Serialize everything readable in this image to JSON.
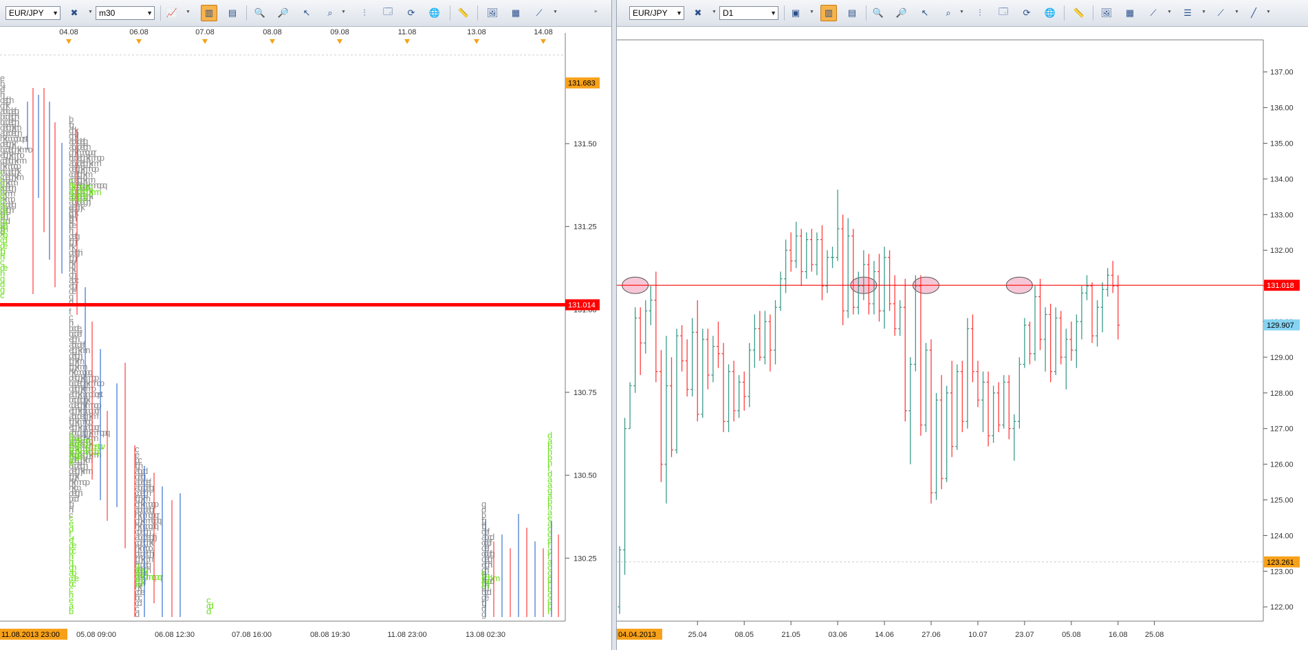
{
  "left_panel": {
    "symbol": "EUR/JPY",
    "timeframe": "m30",
    "price_axis_labels": [
      "131.50",
      "131.25",
      "131.00",
      "130.75",
      "130.50",
      "130.25"
    ],
    "price_axis_values": [
      131.5,
      131.25,
      131.0,
      130.75,
      130.5,
      130.25
    ],
    "top_date_labels": [
      "04.08",
      "06.08",
      "07.08",
      "08.08",
      "09.08",
      "11.08",
      "13.08",
      "14.08"
    ],
    "bottom_time_labels": [
      "05.08 09:00",
      "06.08 12:30",
      "07.08 16:00",
      "08.08 19:30",
      "11.08 23:00",
      "13.08 02:30"
    ],
    "start_marker": "11.08.2013 23:00",
    "high_marker": "131.683",
    "current_price": "131.014"
  },
  "right_panel": {
    "symbol": "EUR/JPY",
    "timeframe": "D1",
    "price_axis_labels": [
      "137.00",
      "136.00",
      "135.00",
      "134.00",
      "133.00",
      "132.00",
      "131.00",
      "130.00",
      "129.00",
      "128.00",
      "127.00",
      "126.00",
      "125.00",
      "124.00",
      "123.00",
      "122.00"
    ],
    "date_labels": [
      "25.04",
      "08.05",
      "21.05",
      "03.06",
      "14.06",
      "27.06",
      "10.07",
      "23.07",
      "05.08",
      "16.08",
      "25.08"
    ],
    "start_marker": "04.04.2013",
    "current_price": "131.018",
    "crosshair_price": "129.907",
    "low_marker": "123.261"
  },
  "colors": {
    "accent_orange": "#f7a11a",
    "current_red": "#ff0000",
    "up_bar": "#3a9a8a",
    "down_bar": "#ff3b3b",
    "highlight_pink": "#f6c6d6",
    "letter_gray": "#8c8c8c",
    "letter_green": "#6de01e",
    "crosshair_blue": "#86d3f2"
  },
  "chart_data": [
    {
      "type": "ohlc",
      "title": "",
      "symbol": "EUR/JPY",
      "timeframe": "m30",
      "ylim": [
        130.06,
        131.73
      ],
      "current_price": 131.014,
      "high_marker": 131.683,
      "notes": "30-minute bars overlaid with market-profile TPO letter columns (gray and green letters)"
    },
    {
      "type": "ohlc",
      "title": "",
      "symbol": "EUR/JPY",
      "timeframe": "D1",
      "ylim": [
        121.6,
        137.9
      ],
      "current_price": 131.018,
      "crosshair_price": 129.907,
      "low_marker": 123.261,
      "highlighted_touches": [
        "09.04",
        "10.06",
        "26.06",
        "22.07"
      ],
      "bars": [
        {
          "d": "04.04",
          "o": 122.0,
          "h": 123.7,
          "l": 121.8,
          "c": 123.6
        },
        {
          "d": "05.04",
          "o": 123.6,
          "h": 127.3,
          "l": 122.9,
          "c": 127.0
        },
        {
          "d": "08.04",
          "o": 127.0,
          "h": 128.3,
          "l": 127.0,
          "c": 128.2
        },
        {
          "d": "09.04",
          "o": 128.2,
          "h": 130.4,
          "l": 128.0,
          "c": 130.1
        },
        {
          "d": "10.04",
          "o": 130.1,
          "h": 130.4,
          "l": 128.5,
          "c": 129.4
        },
        {
          "d": "11.04",
          "o": 129.4,
          "h": 130.6,
          "l": 129.1,
          "c": 130.3
        },
        {
          "d": "12.04",
          "o": 130.3,
          "h": 131.0,
          "l": 129.9,
          "c": 130.6
        },
        {
          "d": "15.04",
          "o": 130.6,
          "h": 131.4,
          "l": 128.3,
          "c": 128.6
        },
        {
          "d": "16.04",
          "o": 128.6,
          "h": 129.2,
          "l": 125.5,
          "c": 126.0
        },
        {
          "d": "17.04",
          "o": 126.0,
          "h": 129.6,
          "l": 124.9,
          "c": 128.2
        },
        {
          "d": "18.04",
          "o": 128.2,
          "h": 129.0,
          "l": 126.2,
          "c": 126.4
        },
        {
          "d": "19.04",
          "o": 126.4,
          "h": 129.8,
          "l": 126.3,
          "c": 129.6
        },
        {
          "d": "22.04",
          "o": 129.6,
          "h": 129.9,
          "l": 128.6,
          "c": 128.9
        },
        {
          "d": "23.04",
          "o": 128.9,
          "h": 129.5,
          "l": 127.9,
          "c": 128.1
        },
        {
          "d": "24.04",
          "o": 128.1,
          "h": 130.1,
          "l": 127.9,
          "c": 129.7
        },
        {
          "d": "25.04",
          "o": 129.7,
          "h": 130.6,
          "l": 127.2,
          "c": 127.4
        },
        {
          "d": "26.04",
          "o": 127.4,
          "h": 129.8,
          "l": 127.3,
          "c": 129.5
        },
        {
          "d": "29.04",
          "o": 129.5,
          "h": 129.8,
          "l": 128.1,
          "c": 128.5
        },
        {
          "d": "30.04",
          "o": 128.5,
          "h": 129.6,
          "l": 128.3,
          "c": 129.3
        },
        {
          "d": "01.05",
          "o": 129.3,
          "h": 130.0,
          "l": 128.7,
          "c": 129.1
        },
        {
          "d": "02.05",
          "o": 129.1,
          "h": 129.4,
          "l": 126.9,
          "c": 127.2
        },
        {
          "d": "03.05",
          "o": 127.2,
          "h": 128.8,
          "l": 126.9,
          "c": 128.6
        },
        {
          "d": "06.05",
          "o": 128.6,
          "h": 128.9,
          "l": 127.2,
          "c": 127.5
        },
        {
          "d": "07.05",
          "o": 127.5,
          "h": 128.5,
          "l": 127.3,
          "c": 128.3
        },
        {
          "d": "08.05",
          "o": 128.3,
          "h": 128.6,
          "l": 127.5,
          "c": 127.9
        },
        {
          "d": "09.05",
          "o": 127.9,
          "h": 129.4,
          "l": 127.6,
          "c": 129.2
        },
        {
          "d": "10.05",
          "o": 129.2,
          "h": 130.2,
          "l": 128.7,
          "c": 129.8
        },
        {
          "d": "13.05",
          "o": 129.8,
          "h": 130.3,
          "l": 128.9,
          "c": 129.0
        },
        {
          "d": "14.05",
          "o": 129.0,
          "h": 130.3,
          "l": 128.8,
          "c": 130.0
        },
        {
          "d": "15.05",
          "o": 130.0,
          "h": 130.2,
          "l": 128.6,
          "c": 129.2
        },
        {
          "d": "16.05",
          "o": 129.2,
          "h": 130.6,
          "l": 128.8,
          "c": 130.4
        },
        {
          "d": "17.05",
          "o": 130.4,
          "h": 131.4,
          "l": 130.3,
          "c": 131.2
        },
        {
          "d": "20.05",
          "o": 131.2,
          "h": 132.3,
          "l": 130.8,
          "c": 132.0
        },
        {
          "d": "21.05",
          "o": 132.0,
          "h": 132.5,
          "l": 131.4,
          "c": 131.7
        },
        {
          "d": "22.05",
          "o": 131.7,
          "h": 132.8,
          "l": 131.5,
          "c": 132.4
        },
        {
          "d": "23.05",
          "o": 132.4,
          "h": 132.6,
          "l": 131.0,
          "c": 131.4
        },
        {
          "d": "24.05",
          "o": 131.4,
          "h": 132.5,
          "l": 131.2,
          "c": 132.3
        },
        {
          "d": "27.05",
          "o": 132.3,
          "h": 132.6,
          "l": 131.4,
          "c": 131.6
        },
        {
          "d": "28.05",
          "o": 131.6,
          "h": 132.5,
          "l": 131.3,
          "c": 132.3
        },
        {
          "d": "29.05",
          "o": 132.3,
          "h": 132.7,
          "l": 130.6,
          "c": 131.0
        },
        {
          "d": "30.05",
          "o": 131.0,
          "h": 132.0,
          "l": 130.8,
          "c": 131.8
        },
        {
          "d": "31.05",
          "o": 131.8,
          "h": 132.1,
          "l": 131.5,
          "c": 131.8
        },
        {
          "d": "03.06",
          "o": 131.8,
          "h": 133.7,
          "l": 131.7,
          "c": 132.6
        },
        {
          "d": "04.06",
          "o": 132.6,
          "h": 133.0,
          "l": 129.9,
          "c": 130.3
        },
        {
          "d": "05.06",
          "o": 130.3,
          "h": 132.9,
          "l": 130.1,
          "c": 132.4
        },
        {
          "d": "06.06",
          "o": 132.4,
          "h": 132.6,
          "l": 130.2,
          "c": 130.4
        },
        {
          "d": "07.06",
          "o": 130.4,
          "h": 131.4,
          "l": 130.2,
          "c": 131.0
        },
        {
          "d": "10.06",
          "o": 131.0,
          "h": 132.0,
          "l": 130.6,
          "c": 131.6
        },
        {
          "d": "11.06",
          "o": 131.6,
          "h": 131.9,
          "l": 130.2,
          "c": 130.5
        },
        {
          "d": "12.06",
          "o": 130.5,
          "h": 131.7,
          "l": 130.2,
          "c": 131.4
        },
        {
          "d": "13.06",
          "o": 131.4,
          "h": 131.9,
          "l": 130.0,
          "c": 130.3
        },
        {
          "d": "14.06",
          "o": 130.3,
          "h": 132.1,
          "l": 129.8,
          "c": 131.8
        },
        {
          "d": "17.06",
          "o": 131.8,
          "h": 132.0,
          "l": 130.3,
          "c": 130.5
        },
        {
          "d": "18.06",
          "o": 130.5,
          "h": 131.3,
          "l": 129.6,
          "c": 129.8
        },
        {
          "d": "19.06",
          "o": 129.8,
          "h": 130.6,
          "l": 129.6,
          "c": 130.4
        },
        {
          "d": "20.06",
          "o": 130.4,
          "h": 131.2,
          "l": 127.2,
          "c": 127.5
        },
        {
          "d": "21.06",
          "o": 127.5,
          "h": 129.0,
          "l": 126.0,
          "c": 128.8
        },
        {
          "d": "24.06",
          "o": 128.8,
          "h": 131.3,
          "l": 128.6,
          "c": 131.0
        },
        {
          "d": "25.06",
          "o": 131.0,
          "h": 131.3,
          "l": 126.8,
          "c": 127.1
        },
        {
          "d": "26.06",
          "o": 127.1,
          "h": 129.4,
          "l": 126.9,
          "c": 129.2
        },
        {
          "d": "27.06",
          "o": 129.2,
          "h": 129.5,
          "l": 124.9,
          "c": 125.2
        },
        {
          "d": "28.06",
          "o": 125.2,
          "h": 128.0,
          "l": 125.0,
          "c": 127.8
        },
        {
          "d": "01.07",
          "o": 127.8,
          "h": 128.5,
          "l": 125.3,
          "c": 125.6
        },
        {
          "d": "02.07",
          "o": 125.6,
          "h": 128.2,
          "l": 125.5,
          "c": 128.0
        },
        {
          "d": "03.07",
          "o": 128.0,
          "h": 128.9,
          "l": 126.2,
          "c": 126.5
        },
        {
          "d": "04.07",
          "o": 126.5,
          "h": 128.8,
          "l": 126.4,
          "c": 128.6
        },
        {
          "d": "05.07",
          "o": 128.6,
          "h": 128.9,
          "l": 126.9,
          "c": 127.2
        },
        {
          "d": "08.07",
          "o": 127.2,
          "h": 130.1,
          "l": 127.0,
          "c": 129.8
        },
        {
          "d": "09.07",
          "o": 129.8,
          "h": 130.2,
          "l": 128.3,
          "c": 128.6
        },
        {
          "d": "10.07",
          "o": 128.6,
          "h": 128.9,
          "l": 127.6,
          "c": 127.8
        },
        {
          "d": "11.07",
          "o": 127.8,
          "h": 128.6,
          "l": 126.9,
          "c": 128.3
        },
        {
          "d": "12.07",
          "o": 128.3,
          "h": 128.6,
          "l": 126.5,
          "c": 126.8
        },
        {
          "d": "15.07",
          "o": 126.8,
          "h": 128.2,
          "l": 126.6,
          "c": 128.0
        },
        {
          "d": "16.07",
          "o": 128.0,
          "h": 128.3,
          "l": 126.9,
          "c": 127.1
        },
        {
          "d": "17.07",
          "o": 127.1,
          "h": 128.5,
          "l": 127.0,
          "c": 128.3
        },
        {
          "d": "18.07",
          "o": 128.3,
          "h": 128.5,
          "l": 126.7,
          "c": 127.0
        },
        {
          "d": "19.07",
          "o": 127.0,
          "h": 127.4,
          "l": 126.1,
          "c": 127.2
        },
        {
          "d": "22.07",
          "o": 127.2,
          "h": 129.0,
          "l": 127.0,
          "c": 128.8
        },
        {
          "d": "23.07",
          "o": 128.8,
          "h": 130.1,
          "l": 128.7,
          "c": 129.9
        },
        {
          "d": "24.07",
          "o": 129.9,
          "h": 130.0,
          "l": 128.8,
          "c": 129.1
        },
        {
          "d": "25.07",
          "o": 129.1,
          "h": 131.0,
          "l": 128.9,
          "c": 130.7
        },
        {
          "d": "26.07",
          "o": 130.7,
          "h": 131.2,
          "l": 129.2,
          "c": 129.5
        },
        {
          "d": "29.07",
          "o": 129.5,
          "h": 130.4,
          "l": 128.6,
          "c": 130.2
        },
        {
          "d": "30.07",
          "o": 130.2,
          "h": 130.5,
          "l": 128.3,
          "c": 128.6
        },
        {
          "d": "31.07",
          "o": 128.6,
          "h": 130.4,
          "l": 128.5,
          "c": 130.1
        },
        {
          "d": "01.08",
          "o": 130.1,
          "h": 130.3,
          "l": 128.8,
          "c": 129.0
        },
        {
          "d": "02.08",
          "o": 129.0,
          "h": 129.8,
          "l": 128.1,
          "c": 129.5
        },
        {
          "d": "05.08",
          "o": 129.5,
          "h": 130.0,
          "l": 128.9,
          "c": 129.2
        },
        {
          "d": "06.08",
          "o": 129.2,
          "h": 130.2,
          "l": 128.7,
          "c": 130.0
        },
        {
          "d": "07.08",
          "o": 130.0,
          "h": 131.0,
          "l": 129.5,
          "c": 130.8
        },
        {
          "d": "08.08",
          "o": 130.8,
          "h": 131.3,
          "l": 130.6,
          "c": 131.0
        },
        {
          "d": "09.08",
          "o": 131.0,
          "h": 131.1,
          "l": 129.4,
          "c": 129.6
        },
        {
          "d": "12.08",
          "o": 129.6,
          "h": 130.6,
          "l": 129.3,
          "c": 130.4
        },
        {
          "d": "13.08",
          "o": 130.4,
          "h": 131.1,
          "l": 129.7,
          "c": 130.9
        },
        {
          "d": "14.08",
          "o": 130.9,
          "h": 131.5,
          "l": 130.7,
          "c": 131.3
        },
        {
          "d": "15.08",
          "o": 131.3,
          "h": 131.7,
          "l": 130.8,
          "c": 131.0
        },
        {
          "d": "16.08",
          "o": 131.0,
          "h": 131.3,
          "l": 129.5,
          "c": 129.9
        }
      ]
    }
  ]
}
